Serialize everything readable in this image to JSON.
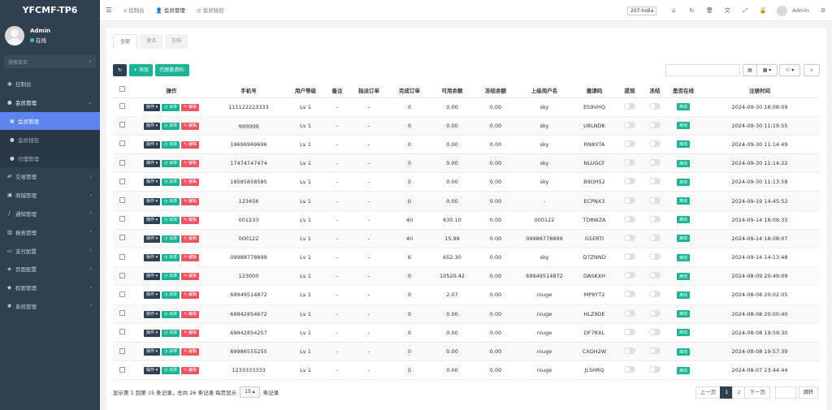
{
  "brand": "YFCMF-TP6",
  "user": {
    "name": "Admin",
    "status": "在线"
  },
  "sidebar": {
    "search_placeholder": "搜索菜单",
    "items": [
      {
        "label": "控制台",
        "icon": "dashboard-icon"
      },
      {
        "label": "会员管理",
        "icon": "user-icon",
        "open": true
      },
      {
        "label": "会员管理",
        "sub": true,
        "active": true
      },
      {
        "label": "会员钱包",
        "sub": true
      },
      {
        "label": "代理管理",
        "sub": true
      },
      {
        "label": "交易管理",
        "icon": "exchange-icon"
      },
      {
        "label": "商城管理",
        "icon": "shop-icon"
      },
      {
        "label": "通知管理",
        "icon": "bell-icon"
      },
      {
        "label": "报表管理",
        "icon": "report-icon"
      },
      {
        "label": "支付配置",
        "icon": "pay-icon"
      },
      {
        "label": "页面配置",
        "icon": "page-icon"
      },
      {
        "label": "权限管理",
        "icon": "permission-icon"
      },
      {
        "label": "系统管理",
        "icon": "system-icon"
      }
    ]
  },
  "topbar": {
    "tabs": [
      "控制台",
      "会员管理",
      "会员钱包"
    ],
    "region": "207-India",
    "user": "Admin"
  },
  "panel": {
    "tabs": [
      "全部",
      "激活",
      "冻结"
    ],
    "toolbar": {
      "add": "+ 添加",
      "invite": "代理邀请码:"
    },
    "columns": [
      "操作",
      "手机号",
      "用户等级",
      "备注",
      "指派订单",
      "完成订单",
      "可用余额",
      "冻结余额",
      "上级用户名",
      "邀请码",
      "提现",
      "冻结",
      "是否在线",
      "注册时间"
    ],
    "row_buttons": {
      "op": "操作",
      "dispatch": "派单",
      "edit": "编辑"
    },
    "online_label": "离线",
    "rows": [
      {
        "phone": "111122223333",
        "level": "Lv 1",
        "note": "-",
        "assigned": "-",
        "done": "0",
        "balance": "0.00",
        "frozen": "0.00",
        "parent": "sky",
        "code": "ES9VHQ",
        "time": "2024-09-30 16:08:09"
      },
      {
        "phone": "qqqqqq",
        "level": "Lv 1",
        "note": "-",
        "assigned": "-",
        "done": "0",
        "balance": "0.00",
        "frozen": "0.00",
        "parent": "sky",
        "code": "U8LNDK",
        "time": "2024-09-30 11:19:55"
      },
      {
        "phone": "19696969696",
        "level": "Lv 1",
        "note": "-",
        "assigned": "-",
        "done": "0",
        "balance": "0.00",
        "frozen": "0.00",
        "parent": "sky",
        "code": "RN8XTA",
        "time": "2024-09-30 11:14:49"
      },
      {
        "phone": "17474747474",
        "level": "Lv 1",
        "note": "-",
        "assigned": "-",
        "done": "0",
        "balance": "0.00",
        "frozen": "0.00",
        "parent": "sky",
        "code": "NLUGCF",
        "time": "2024-09-30 11:14:22"
      },
      {
        "phone": "18585858585",
        "level": "Lv 1",
        "note": "-",
        "assigned": "-",
        "done": "0",
        "balance": "0.00",
        "frozen": "0.00",
        "parent": "sky",
        "code": "B9DH52",
        "time": "2024-09-30 11:13:58"
      },
      {
        "phone": "123456",
        "level": "Lv 1",
        "note": "-",
        "assigned": "-",
        "done": "0",
        "balance": "0.00",
        "frozen": "0.00",
        "parent": "-",
        "code": "ECPNX3",
        "time": "2024-09-19 14:45:52"
      },
      {
        "phone": "001233",
        "level": "Lv 1",
        "note": "-",
        "assigned": "-",
        "done": "40",
        "balance": "630.10",
        "frozen": "0.00",
        "parent": "000122",
        "code": "TD8WZA",
        "time": "2024-09-14 18:08:33"
      },
      {
        "phone": "000122",
        "level": "Lv 1",
        "note": "-",
        "assigned": "-",
        "done": "40",
        "balance": "15.99",
        "frozen": "0.00",
        "parent": "09988778899",
        "code": "G5ERTI",
        "time": "2024-09-14 18:08:07"
      },
      {
        "phone": "09988778899",
        "level": "Lv 1",
        "note": "-",
        "assigned": "-",
        "done": "6",
        "balance": "652.30",
        "frozen": "0.00",
        "parent": "sky",
        "code": "Q7ZNND",
        "time": "2024-09-14 14:13:48"
      },
      {
        "phone": "123000",
        "level": "Lv 1",
        "note": "-",
        "assigned": "-",
        "done": "0",
        "balance": "10520.42",
        "frozen": "0.00",
        "parent": "69949514872",
        "code": "DASKXH",
        "time": "2024-08-09 20:49:09"
      },
      {
        "phone": "69949514872",
        "level": "Lv 1",
        "note": "-",
        "assigned": "-",
        "done": "0",
        "balance": "2.07",
        "frozen": "0.00",
        "parent": "niuge",
        "code": "MP8YT2",
        "time": "2024-08-08 20:02:05"
      },
      {
        "phone": "69942854672",
        "level": "Lv 1",
        "note": "-",
        "assigned": "-",
        "done": "0",
        "balance": "0.00",
        "frozen": "0.00",
        "parent": "niuge",
        "code": "HLZ9DE",
        "time": "2024-08-08 20:00:40"
      },
      {
        "phone": "69942854257",
        "level": "Lv 1",
        "note": "-",
        "assigned": "-",
        "done": "0",
        "balance": "0.00",
        "frozen": "0.00",
        "parent": "niuge",
        "code": "DF7RXL",
        "time": "2024-08-08 19:59:30"
      },
      {
        "phone": "69986555255",
        "level": "Lv 1",
        "note": "-",
        "assigned": "-",
        "done": "0",
        "balance": "0.00",
        "frozen": "0.00",
        "parent": "niuge",
        "code": "CXGH2W",
        "time": "2024-08-08 19:57:39"
      },
      {
        "phone": "1233333333",
        "level": "Lv 1",
        "note": "-",
        "assigned": "-",
        "done": "0",
        "balance": "0.00",
        "frozen": "0.00",
        "parent": "niuge",
        "code": "JLSHRQ",
        "time": "2024-08-07 23:44:44"
      }
    ],
    "footer": {
      "summary": "显示第 1 到第 15 条记录，总共 26 条记录 每页显示",
      "page_size": "15 ▴",
      "suffix": "条记录"
    },
    "pager": {
      "prev": "上一页",
      "pages": [
        "1",
        "2"
      ],
      "next": "下一页",
      "go": "跳转"
    }
  },
  "colors": {
    "sidebar": "#2f4050",
    "active": "#5e84f0",
    "green": "#1ab394",
    "red": "#ed5565"
  }
}
